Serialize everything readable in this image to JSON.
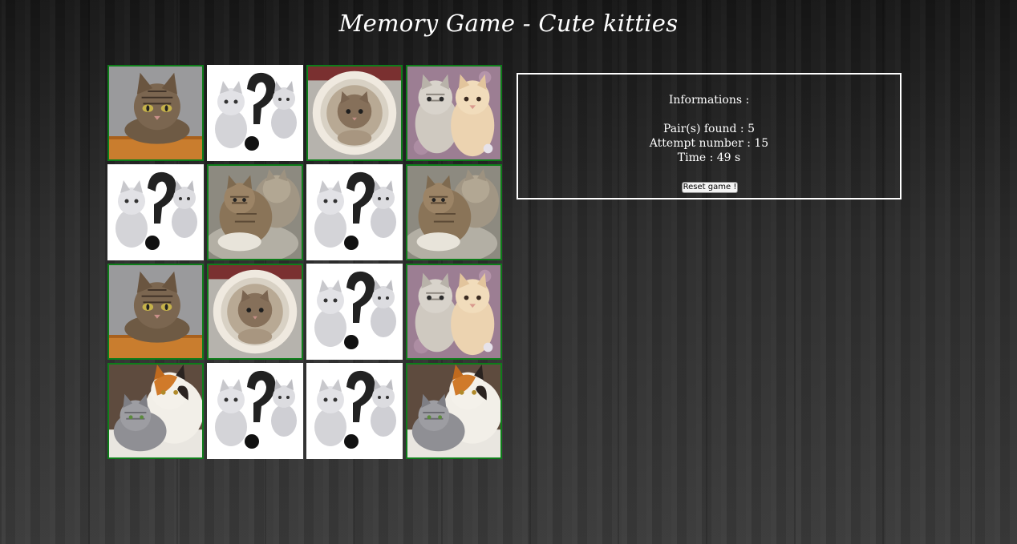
{
  "page": {
    "title": "Memory Game - Cute kitties"
  },
  "colors": {
    "revealed_border": "#0e7d1a",
    "panel_border": "#ffffff",
    "text": "#ffffff"
  },
  "board": {
    "rows": 4,
    "cols": 4,
    "cards": [
      {
        "state": "revealed",
        "image": "tabby-cat-on-table"
      },
      {
        "state": "hidden",
        "image": "question-mark-kittens"
      },
      {
        "state": "revealed",
        "image": "kitten-in-cup"
      },
      {
        "state": "revealed",
        "image": "two-kittens-pink-blanket"
      },
      {
        "state": "hidden",
        "image": "question-mark-kittens"
      },
      {
        "state": "revealed",
        "image": "kittens-cuddling"
      },
      {
        "state": "hidden",
        "image": "question-mark-kittens"
      },
      {
        "state": "revealed",
        "image": "kittens-cuddling"
      },
      {
        "state": "revealed",
        "image": "tabby-cat-on-table"
      },
      {
        "state": "revealed",
        "image": "kitten-in-cup"
      },
      {
        "state": "hidden",
        "image": "question-mark-kittens"
      },
      {
        "state": "revealed",
        "image": "two-kittens-pink-blanket"
      },
      {
        "state": "revealed",
        "image": "calico-and-grey-kittens"
      },
      {
        "state": "hidden",
        "image": "question-mark-kittens"
      },
      {
        "state": "hidden",
        "image": "question-mark-kittens"
      },
      {
        "state": "revealed",
        "image": "calico-and-grey-kittens"
      }
    ]
  },
  "info": {
    "heading": "Informations :",
    "pairs_found": "Pair(s) found : 5",
    "attempts": "Attempt number : 15",
    "time": "Time : 49 s",
    "reset_label": "Reset game !"
  }
}
